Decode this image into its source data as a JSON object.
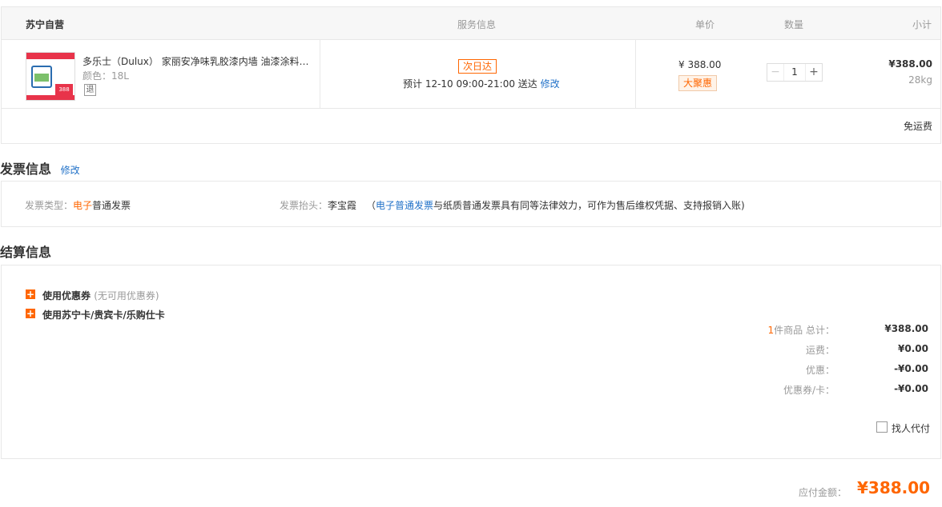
{
  "order": {
    "store": "苏宁自营",
    "headers": {
      "service": "服务信息",
      "price": "单价",
      "qty": "数量",
      "subtotal": "小计"
    },
    "item": {
      "title": "多乐士（Dulux） 家丽安净味乳胶漆内墙 油漆涂料 ...",
      "color_label": "颜色：18L",
      "return_badge": "退",
      "thumb_price": "388",
      "service_tag": "次日达",
      "delivery_text": "预计 12-10 09:00-21:00  送达",
      "delivery_edit": "修改",
      "price": "¥ 388.00",
      "promo": "大聚惠",
      "qty": "1",
      "qty_minus": "−",
      "qty_plus": "+",
      "subtotal": "¥388.00",
      "weight": "28kg"
    },
    "shipping_note": "免运费"
  },
  "invoice": {
    "title": "发票信息",
    "edit": "修改",
    "type_label": "发票类型：",
    "type_highlight": "电子",
    "type_rest": "普通发票",
    "header_label": "发票抬头：",
    "header_value": "李宝霞",
    "note_open": "（",
    "note_link": "电子普通发票",
    "note_rest": "与纸质普通发票具有同等法律效力，可作为售后维权凭据、支持报销入账)"
  },
  "settlement": {
    "title": "结算信息",
    "options": [
      {
        "icon": "+",
        "label": "使用优惠券",
        "sub": "(无可用优惠券)"
      },
      {
        "icon": "+",
        "label": "使用苏宁卡/贵宾卡/乐购仕卡",
        "sub": ""
      }
    ],
    "summary": [
      {
        "prefix": "1",
        "label": "件商品 总计：",
        "value": "¥388.00"
      },
      {
        "prefix": "",
        "label": "运费：",
        "value": "¥0.00"
      },
      {
        "prefix": "",
        "label": "优惠：",
        "value": "-¥0.00"
      },
      {
        "prefix": "",
        "label": "优惠券/卡：",
        "value": "-¥0.00"
      }
    ],
    "proxy_pay": "找人代付"
  },
  "payment": {
    "label": "应付金额：",
    "amount": "¥388.00"
  },
  "colors": {
    "accent": "#ff6600",
    "link": "#2272c8",
    "border": "#e8e8e8"
  }
}
